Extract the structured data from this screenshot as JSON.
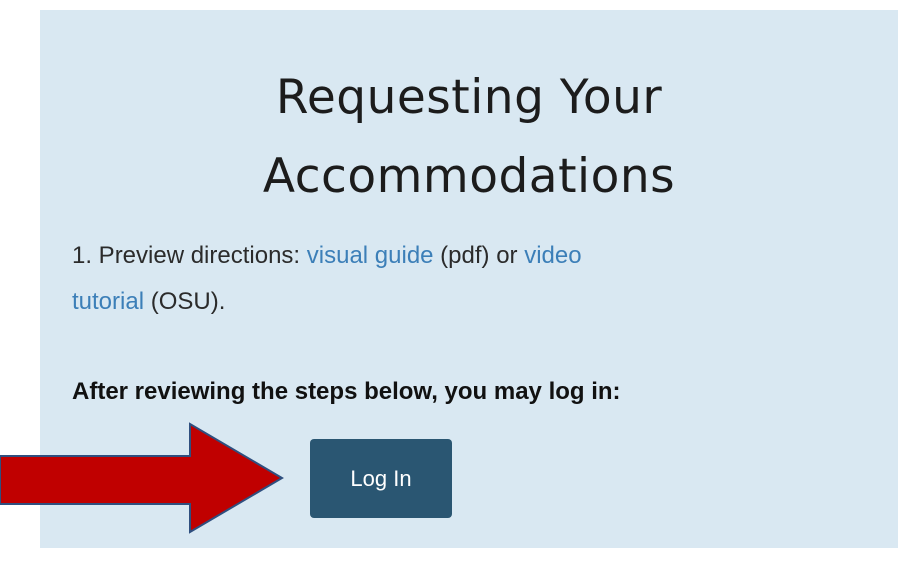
{
  "page": {
    "heading_line1": "Requesting Your",
    "heading_line2": "Accommodations",
    "step": {
      "prefix": "1.  Preview directions: ",
      "link1": "visual guide",
      "middle": " (pdf) or ",
      "link2_part1": "video",
      "link2_part2": "tutorial",
      "suffix": " (OSU)."
    },
    "after_text": "After reviewing the steps below, you may log in:",
    "login_button": "Log In"
  },
  "colors": {
    "panel_bg": "#d9e8f2",
    "link": "#3c7fb8",
    "button_bg": "#2a5672",
    "arrow_fill": "#c00000",
    "arrow_stroke": "#2f4f7f"
  }
}
